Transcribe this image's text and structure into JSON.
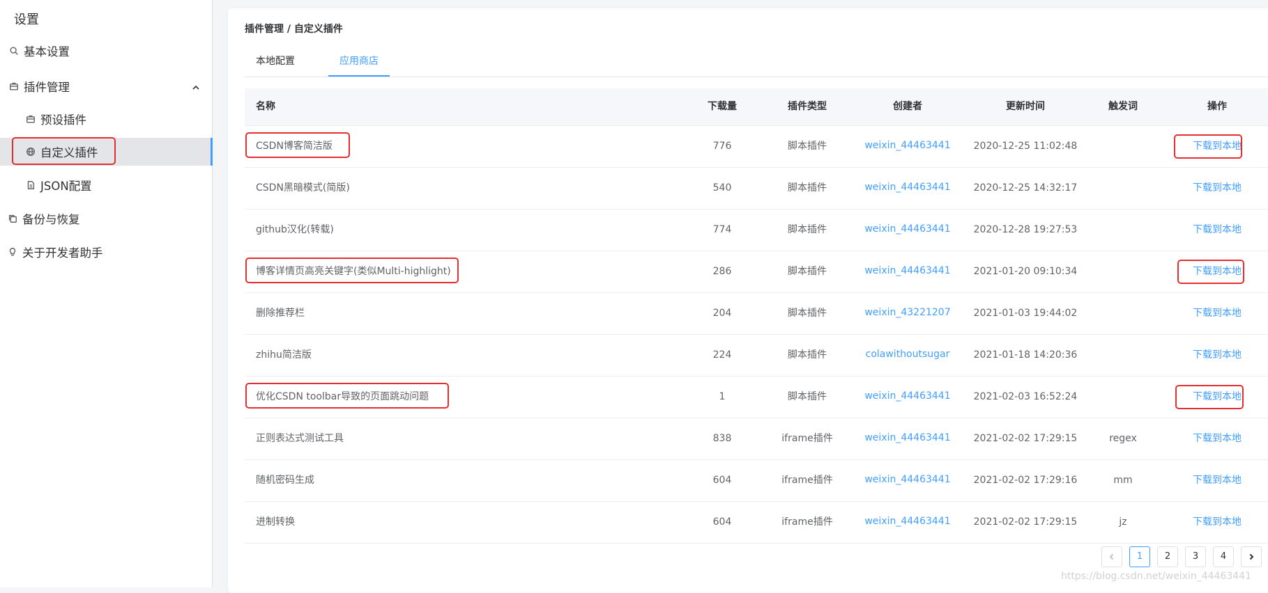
{
  "sidebar": {
    "title": "设置",
    "items": [
      {
        "label": "基本设置",
        "icon": "search-icon"
      },
      {
        "label": "插件管理",
        "icon": "briefcase-icon",
        "expanded": true
      },
      {
        "label": "预设插件",
        "icon": "briefcase-icon"
      },
      {
        "label": "自定义插件",
        "icon": "globe-icon",
        "active": true
      },
      {
        "label": "JSON配置",
        "icon": "document-icon"
      },
      {
        "label": "备份与恢复",
        "icon": "copy-icon"
      },
      {
        "label": "关于开发者助手",
        "icon": "lightbulb-icon"
      }
    ]
  },
  "main": {
    "breadcrumb": "插件管理 / 自定义插件",
    "tabs": [
      {
        "label": "本地配置",
        "active": false
      },
      {
        "label": "应用商店",
        "active": true
      }
    ],
    "table": {
      "headers": [
        "名称",
        "下载量",
        "插件类型",
        "创建者",
        "更新时间",
        "触发词",
        "操作"
      ],
      "rows": [
        {
          "name": "CSDN博客简洁版",
          "downloads": "776",
          "type": "脚本插件",
          "creator": "weixin_44463441",
          "updated": "2020-12-25 11:02:48",
          "trigger": "",
          "action": "下载到本地"
        },
        {
          "name": "CSDN黑暗模式(简版)",
          "downloads": "540",
          "type": "脚本插件",
          "creator": "weixin_44463441",
          "updated": "2020-12-25 14:32:17",
          "trigger": "",
          "action": "下载到本地"
        },
        {
          "name": "github汉化(转载)",
          "downloads": "774",
          "type": "脚本插件",
          "creator": "weixin_44463441",
          "updated": "2020-12-28 19:27:53",
          "trigger": "",
          "action": "下载到本地"
        },
        {
          "name": "博客详情页高亮关键字(类似Multi-highlight)",
          "downloads": "286",
          "type": "脚本插件",
          "creator": "weixin_44463441",
          "updated": "2021-01-20 09:10:34",
          "trigger": "",
          "action": "下载到本地"
        },
        {
          "name": "删除推荐栏",
          "downloads": "204",
          "type": "脚本插件",
          "creator": "weixin_43221207",
          "updated": "2021-01-03 19:44:02",
          "trigger": "",
          "action": "下载到本地"
        },
        {
          "name": "zhihu简洁版",
          "downloads": "224",
          "type": "脚本插件",
          "creator": "colawithoutsugar",
          "updated": "2021-01-18 14:20:36",
          "trigger": "",
          "action": "下载到本地"
        },
        {
          "name": "优化CSDN toolbar导致的页面跳动问题",
          "downloads": "1",
          "type": "脚本插件",
          "creator": "weixin_44463441",
          "updated": "2021-02-03 16:52:24",
          "trigger": "",
          "action": "下载到本地"
        },
        {
          "name": "正则表达式测试工具",
          "downloads": "838",
          "type": "iframe插件",
          "creator": "weixin_44463441",
          "updated": "2021-02-02 17:29:15",
          "trigger": "regex",
          "action": "下载到本地"
        },
        {
          "name": "随机密码生成",
          "downloads": "604",
          "type": "iframe插件",
          "creator": "weixin_44463441",
          "updated": "2021-02-02 17:29:16",
          "trigger": "mm",
          "action": "下载到本地"
        },
        {
          "name": "进制转换",
          "downloads": "604",
          "type": "iframe插件",
          "creator": "weixin_44463441",
          "updated": "2021-02-02 17:29:15",
          "trigger": "jz",
          "action": "下载到本地"
        }
      ]
    },
    "pagination": {
      "pages": [
        "1",
        "2",
        "3",
        "4"
      ],
      "current": "1"
    }
  },
  "watermark": "https://blog.csdn.net/weixin_44463441",
  "colors": {
    "accent": "#409eff",
    "annotation": "#e52d2d"
  }
}
